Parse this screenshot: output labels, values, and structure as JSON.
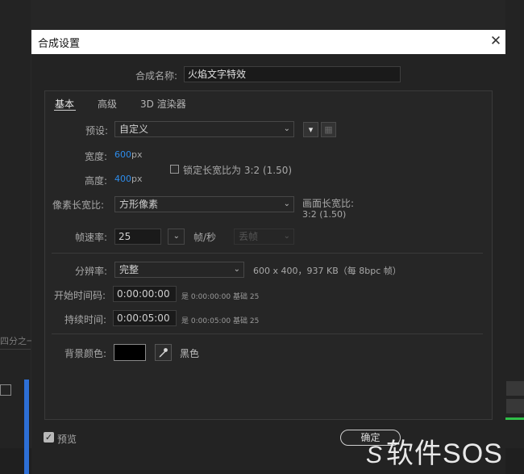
{
  "background": {
    "panel_label": "四分之一"
  },
  "dialog": {
    "title": "合成设置",
    "close": "✕",
    "name_label": "合成名称:",
    "name_value": "火焰文字特效",
    "tabs": [
      "基本",
      "高级",
      "3D 渲染器"
    ],
    "preset_label": "预设:",
    "preset_value": "自定义",
    "width_label": "宽度:",
    "width_value": "600",
    "height_label": "高度:",
    "height_value": "400",
    "unit_px": "px",
    "lock_aspect_label": "锁定长宽比为 3:2 (1.50)",
    "pixel_aspect_label": "像素长宽比:",
    "pixel_aspect_value": "方形像素",
    "frame_aspect_label": "画面长宽比:",
    "frame_aspect_value": "3:2 (1.50)",
    "fps_label": "帧速率:",
    "fps_value": "25",
    "fps_unit": "帧/秒",
    "dropframe_value": "丢帧",
    "resolution_label": "分辨率:",
    "resolution_value": "完整",
    "resolution_info": "600 x 400，937 KB（每 8bpc 帧）",
    "start_tc_label": "开始时间码:",
    "start_tc_value": "0:00:00:00",
    "start_tc_info": "是 0:00:00:00",
    "start_tc_base": "基础 25",
    "duration_label": "持续时间:",
    "duration_value": "0:00:05:00",
    "duration_info": "是 0:00:05:00",
    "duration_base": "基础 25",
    "bg_color_label": "背景颜色:",
    "bg_color_name": "黑色",
    "bg_color_hex": "#000000",
    "preview_label": "预览",
    "ok_label": "确定"
  },
  "watermark": "软件SOS"
}
